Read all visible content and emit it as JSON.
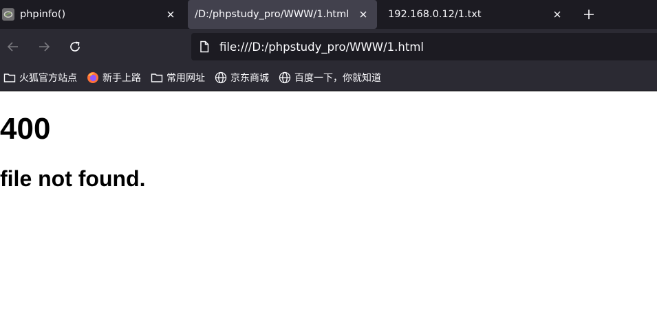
{
  "tabs": [
    {
      "title": "phpinfo()",
      "icon": "php-favicon-icon",
      "active": false
    },
    {
      "title": "/D:/phpstudy_pro/WWW/1.html",
      "icon": null,
      "active": true
    },
    {
      "title": "192.168.0.12/1.txt",
      "icon": null,
      "active": false
    }
  ],
  "navbar": {
    "url": "file:///D:/phpstudy_pro/WWW/1.html",
    "url_icon": "page-icon"
  },
  "bookmarks": [
    {
      "label": "火狐官方站点",
      "icon": "folder-icon"
    },
    {
      "label": "新手上路",
      "icon": "firefox-icon"
    },
    {
      "label": "常用网址",
      "icon": "folder-icon"
    },
    {
      "label": "京东商城",
      "icon": "globe-icon"
    },
    {
      "label": "百度一下，你就知道",
      "icon": "globe-icon"
    }
  ],
  "page": {
    "heading": "400",
    "message": "file not found."
  },
  "colors": {
    "tabstrip_bg": "#1c1b22",
    "active_tab_bg": "#42414d",
    "toolbar_bg": "#2b2a33",
    "urlbar_bg": "#1c1b22",
    "text_light": "#fbfbfe",
    "page_bg": "#ffffff",
    "page_text": "#000000"
  }
}
